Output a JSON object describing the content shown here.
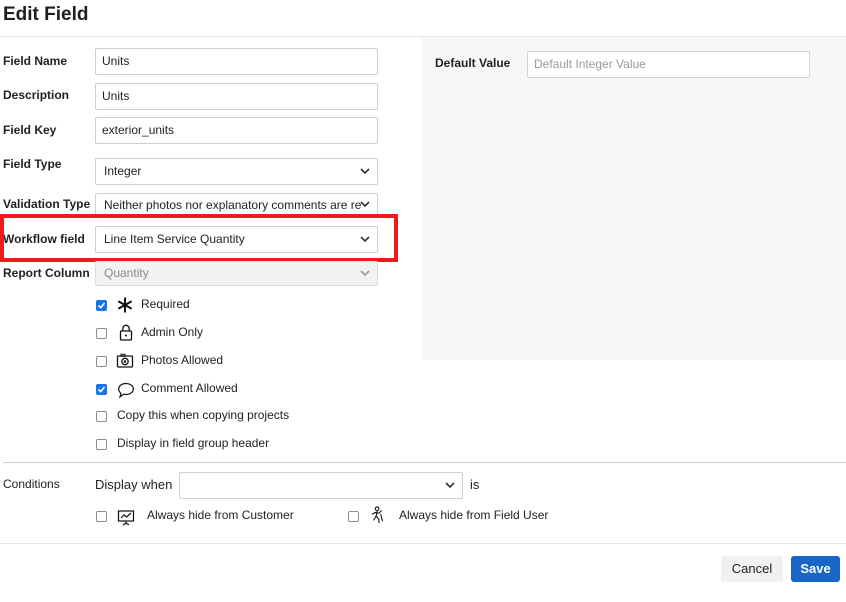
{
  "dialog": {
    "title": "Edit Field"
  },
  "form": {
    "field_name": {
      "label": "Field Name",
      "value": "Units"
    },
    "description": {
      "label": "Description",
      "value": "Units"
    },
    "field_key": {
      "label": "Field Key",
      "value": "exterior_units"
    },
    "field_type": {
      "label": "Field Type",
      "value": "Integer"
    },
    "validation_type": {
      "label": "Validation Type",
      "value": "Neither photos nor explanatory comments are re"
    },
    "workflow_field": {
      "label": "Workflow field",
      "value": "Line Item Service Quantity"
    },
    "report_column": {
      "label": "Report Column",
      "value": "Quantity"
    }
  },
  "default_value": {
    "label": "Default Value",
    "placeholder": "Default Integer Value"
  },
  "options": [
    {
      "label": "Required",
      "checked": true,
      "icon": "asterisk-icon"
    },
    {
      "label": "Admin Only",
      "checked": false,
      "icon": "lock-icon"
    },
    {
      "label": "Photos Allowed",
      "checked": false,
      "icon": "camera-icon"
    },
    {
      "label": "Comment Allowed",
      "checked": true,
      "icon": "speech-bubble-icon"
    },
    {
      "label": "Copy this when copying projects",
      "checked": false
    },
    {
      "label": "Display in field group header",
      "checked": false
    }
  ],
  "conditions": {
    "label": "Conditions",
    "display_when": "Display when",
    "is": "is",
    "hide_customer": {
      "label": "Always hide from Customer",
      "checked": false,
      "icon": "presentation-icon"
    },
    "hide_field_user": {
      "label": "Always hide from Field User",
      "checked": false,
      "icon": "worker-icon"
    }
  },
  "buttons": {
    "cancel": "Cancel",
    "save": "Save"
  },
  "colors": {
    "highlight": "#ec1c1c",
    "primary": "#1966c8",
    "checkbox": "#1a73e8"
  }
}
